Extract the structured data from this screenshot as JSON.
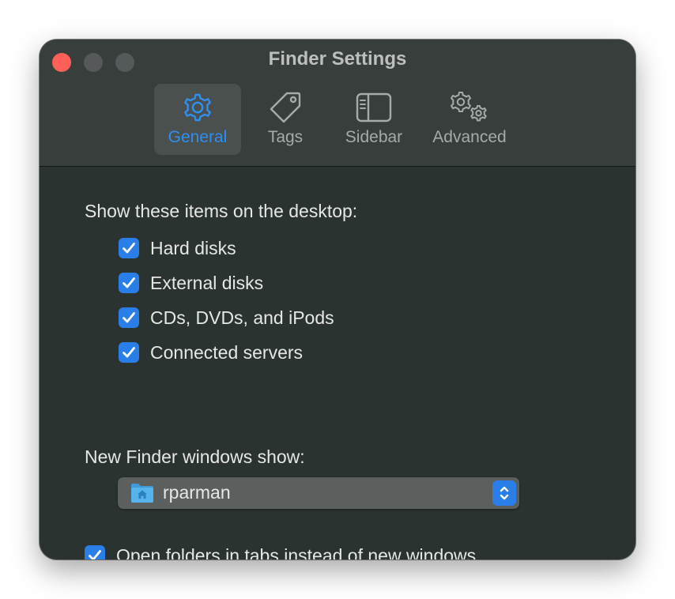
{
  "window": {
    "title": "Finder Settings"
  },
  "tabs": [
    {
      "label": "General",
      "icon": "gear-icon",
      "active": true
    },
    {
      "label": "Tags",
      "icon": "tag-icon",
      "active": false
    },
    {
      "label": "Sidebar",
      "icon": "sidebar-icon",
      "active": false
    },
    {
      "label": "Advanced",
      "icon": "gears-icon",
      "active": false
    }
  ],
  "desktop": {
    "heading": "Show these items on the desktop:",
    "items": [
      {
        "label": "Hard disks",
        "checked": true
      },
      {
        "label": "External disks",
        "checked": true
      },
      {
        "label": "CDs, DVDs, and iPods",
        "checked": true
      },
      {
        "label": "Connected servers",
        "checked": true
      }
    ]
  },
  "new_windows": {
    "heading": "New Finder windows show:",
    "selected": "rparman",
    "icon": "home-folder-icon"
  },
  "open_in_tabs": {
    "label": "Open folders in tabs instead of new windows",
    "checked": true
  },
  "colors": {
    "accent": "#2a7ee8",
    "close_button": "#fe5f57",
    "window_background": "#2b3330",
    "toolbar_background": "#383e3b"
  }
}
